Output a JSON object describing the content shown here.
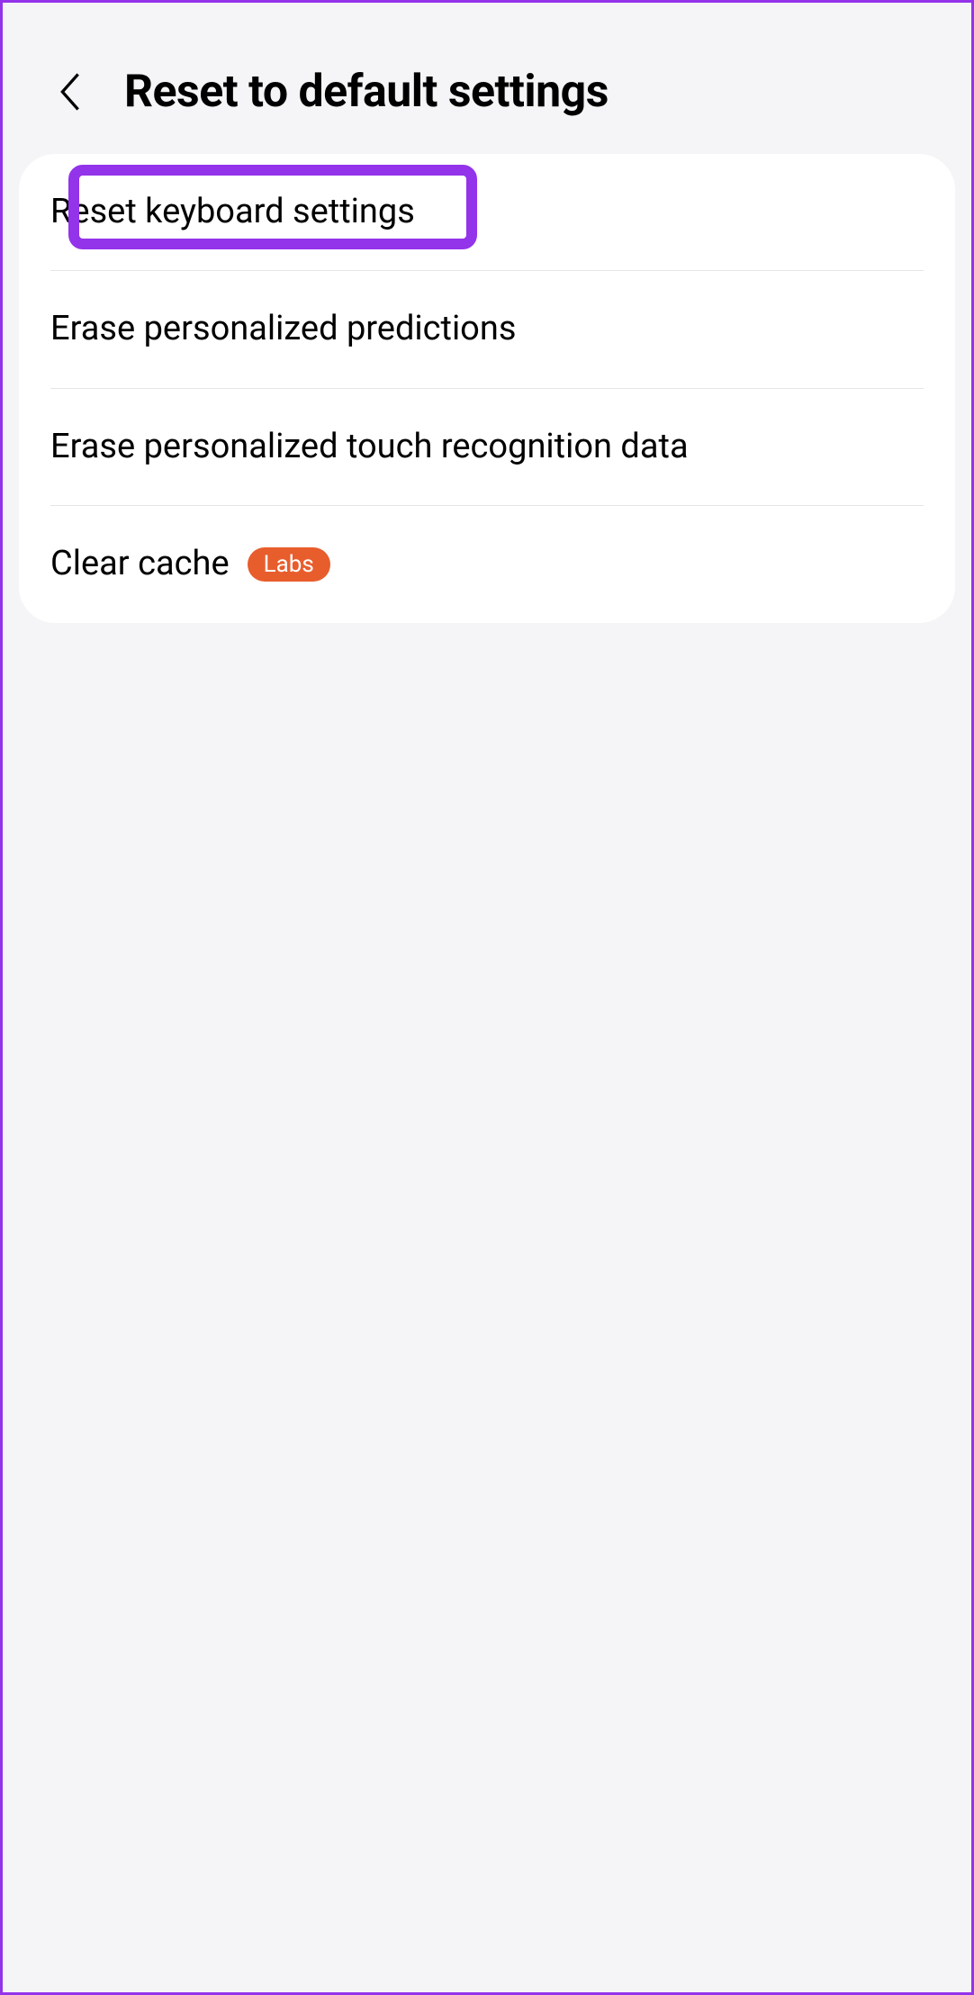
{
  "header": {
    "title": "Reset to default settings"
  },
  "items": [
    {
      "label": "Reset keyboard settings",
      "highlighted": true
    },
    {
      "label": "Erase personalized predictions"
    },
    {
      "label": "Erase personalized touch recognition data"
    },
    {
      "label": "Clear cache",
      "badge": "Labs"
    }
  ]
}
